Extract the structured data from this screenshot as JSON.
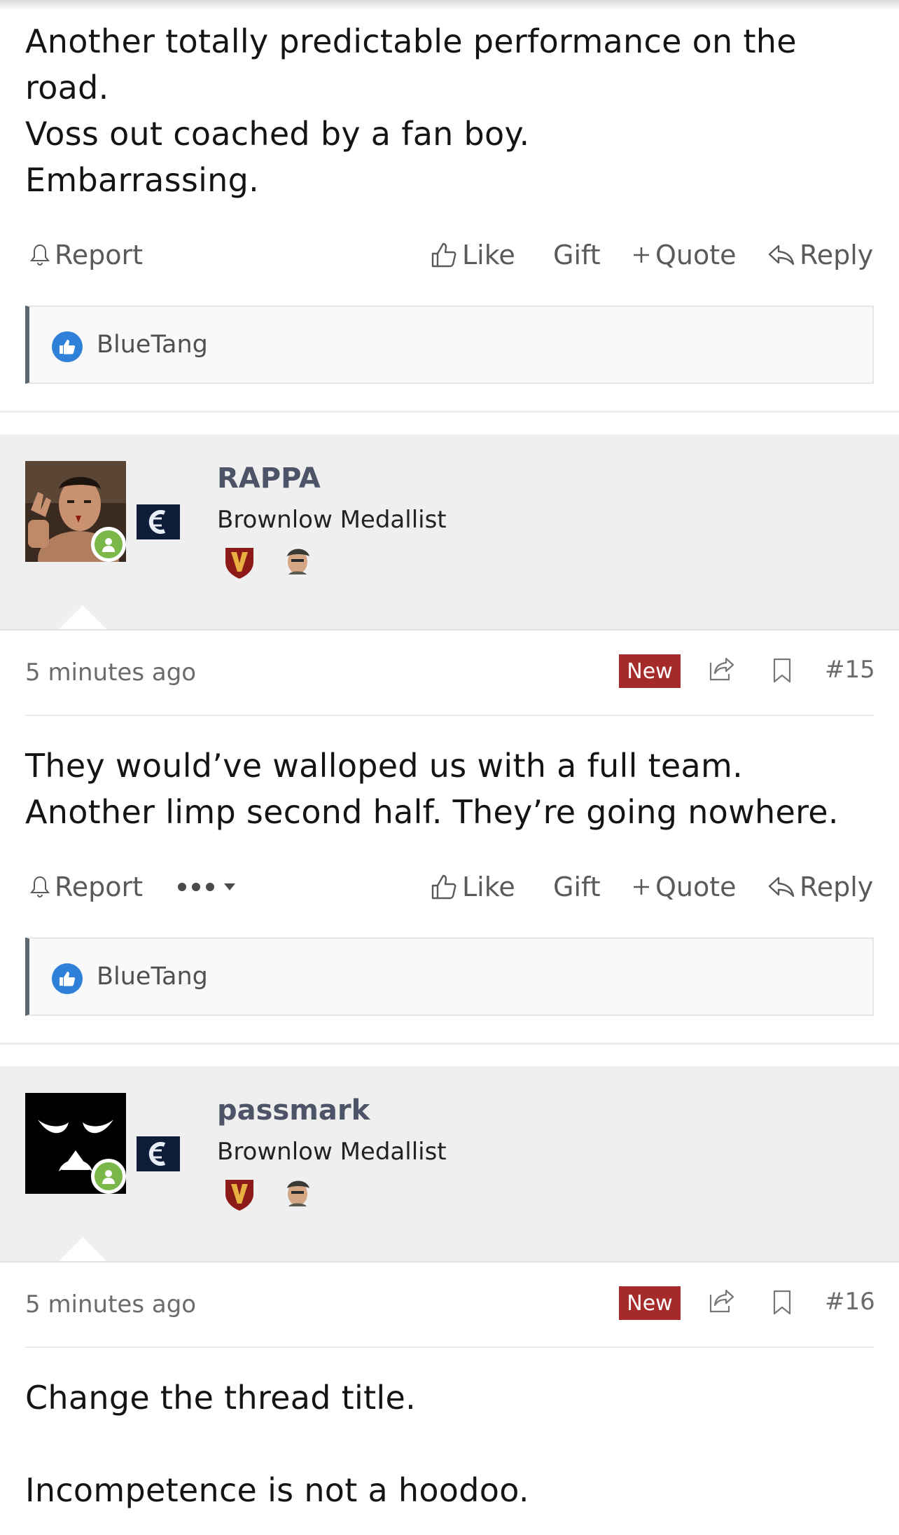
{
  "actions": {
    "report": "Report",
    "like": "Like",
    "gift": "Gift",
    "quote": "Quote",
    "reply": "Reply"
  },
  "posts": [
    {
      "body": "Another totally predictable performance on the\nroad.\nVoss out coached by a fan boy.\nEmbarrassing.",
      "likers": [
        "BlueTang"
      ]
    },
    {
      "author": "RAPPA",
      "user_title": "Brownlow Medallist",
      "time": "5 minutes ago",
      "badge": "New",
      "post_number": "#15",
      "body": "They would’ve walloped us with a full team.\nAnother limp second half. They’re going nowhere.",
      "likers": [
        "BlueTang"
      ]
    },
    {
      "author": "passmark",
      "user_title": "Brownlow Medallist",
      "time": "5 minutes ago",
      "badge": "New",
      "post_number": "#16",
      "body": "Change the thread title.\n\nIncompetence is not a hoodoo."
    }
  ],
  "colors": {
    "new_badge": "#a52a2a",
    "username": "#4d5468",
    "online": "#7bb84a",
    "like_icon": "#2f80d8"
  }
}
